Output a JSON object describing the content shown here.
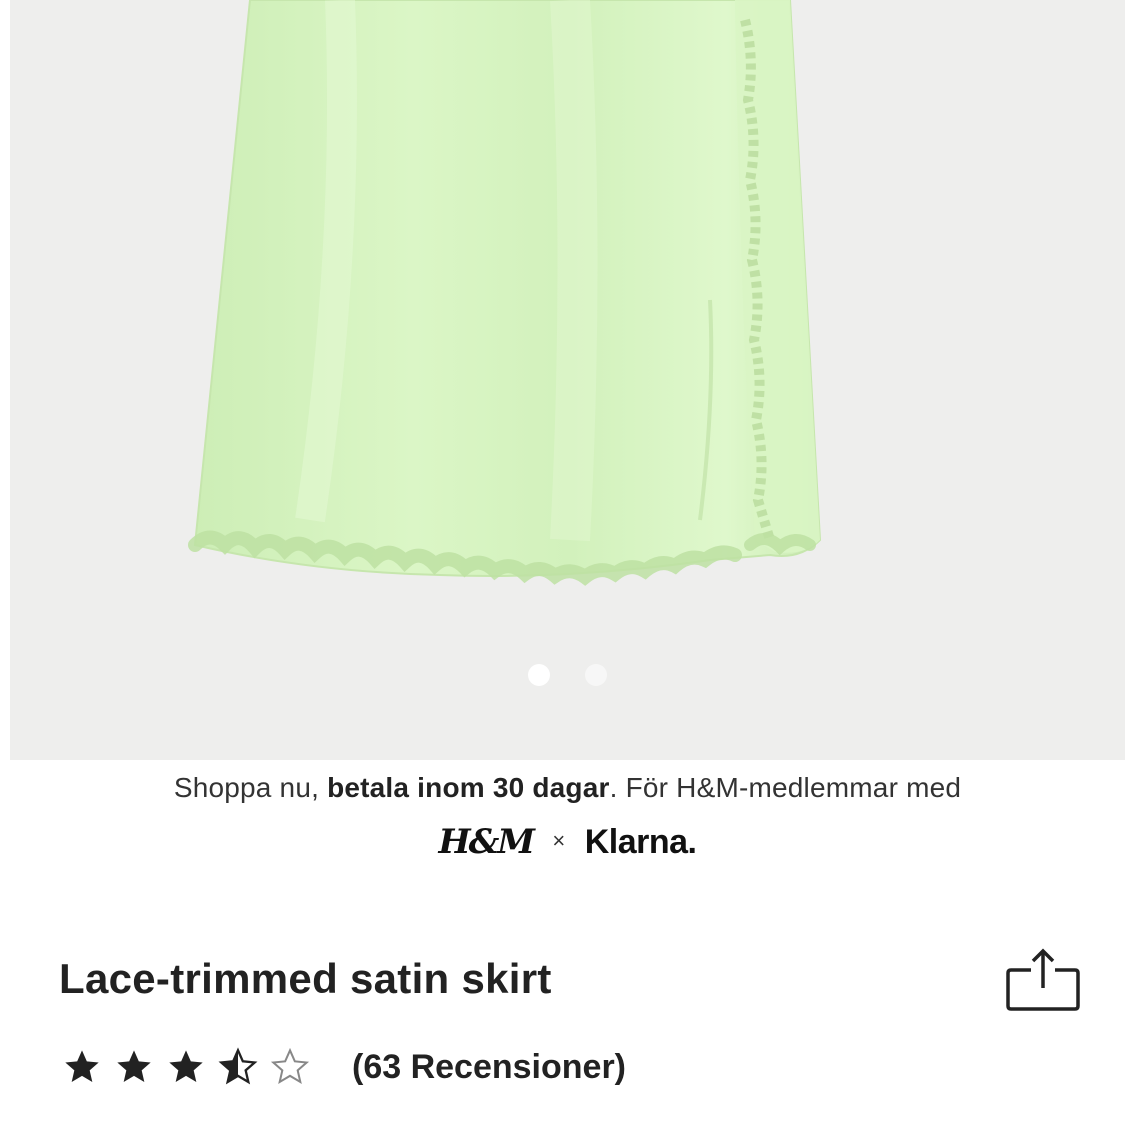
{
  "product": {
    "image_alt": "Light green satin skirt with lace trim",
    "colors": {
      "skirt": "#d3f2bd",
      "lace": "#c3e5a8",
      "background": "#eeeeed"
    },
    "gallery": {
      "count": 2,
      "active_index": 0
    }
  },
  "promo": {
    "text_prefix": "Shoppa nu, ",
    "text_bold": "betala inom 30 dagar",
    "text_suffix": ". För H&M-medlemmar med",
    "brand_hm": "H&M",
    "brand_separator": "×",
    "brand_klarna": "Klarna."
  },
  "title": "Lace-trimmed satin skirt",
  "share_icon": "share-icon",
  "rating": {
    "value": 3.5,
    "max": 5,
    "reviews_label": "(63 Recensioner)"
  }
}
